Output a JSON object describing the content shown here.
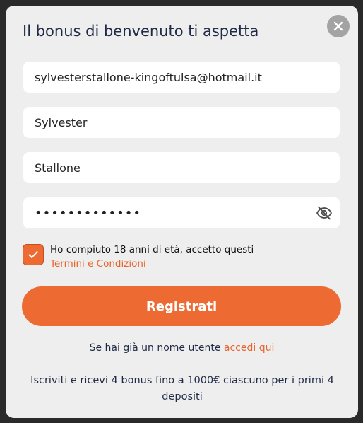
{
  "modal": {
    "title": "Il bonus di benvenuto ti aspetta",
    "close_icon": "close-icon"
  },
  "form": {
    "email_value": "sylvesterstallone-kingoftulsa@hotmail.it",
    "first_name_value": "Sylvester",
    "last_name_value": "Stallone",
    "password_masked": "•••••••••••••",
    "password_toggle_icon": "eye-slash-icon"
  },
  "consent": {
    "checked": true,
    "text": "Ho compiuto 18 anni di età, accetto questi",
    "terms_link": "Termini e Condizioni"
  },
  "actions": {
    "register_label": "Registrati",
    "login_prompt": "Se hai già un nome utente",
    "login_link": "accedi qui"
  },
  "promo_text": "Iscriviti e ricevi 4 bonus fino a 1000€ ciascuno per i primi 4 depositi",
  "colors": {
    "accent": "#ed6a33",
    "background": "#eeeeee",
    "text": "#1f2a44"
  }
}
